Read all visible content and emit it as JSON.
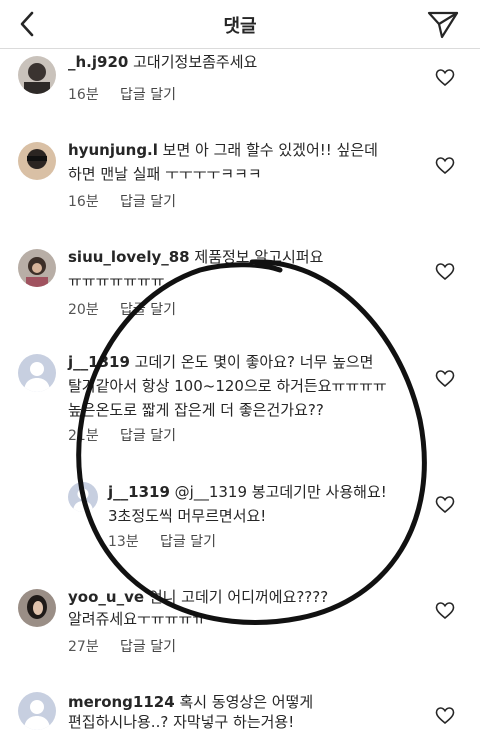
{
  "header": {
    "title": "댓글"
  },
  "comments": [
    {
      "username": "_h.j920",
      "lines": [
        "고대기정보좀주세요"
      ],
      "time": "16분",
      "reply_label": "답글 달기"
    },
    {
      "username": "hyunjung.l",
      "lines": [
        "보면 아 그래 할수 있겠어!! 싶은데",
        "하면 맨날 실패 ㅜㅜㅜㅜㅋㅋㅋ"
      ],
      "time": "16분",
      "reply_label": "답글 달기"
    },
    {
      "username": "siuu_lovely_88",
      "lines": [
        "제품정보 알고시퍼요",
        "ㅠㅠㅠㅠㅠㅠㅠ"
      ],
      "time": "20분",
      "reply_label": "답글 달기"
    },
    {
      "username": "j__1319",
      "lines": [
        "고데기 온도 몇이 좋아요? 너무 높으면",
        "탈거같아서 항상 100~120으로 하거든요ㅠㅠㅠㅠ",
        "높은온도로 짧게 잡은게 더 좋은건가요??"
      ],
      "time": "21분",
      "reply_label": "답글 달기"
    },
    {
      "username": "j__1319",
      "lines": [
        "@j__1319 봉고데기만 사용해요!",
        "3초정도씩 머무르면서요!"
      ],
      "time": "13분",
      "reply_label": "답글 달기"
    },
    {
      "username": "yoo_u_ve",
      "lines": [
        "언니 고데기 어디꺼에요????",
        "알려쥬세요ㅜㅠㅠㅠㅠ"
      ],
      "time": "27분",
      "reply_label": "답글 달기"
    },
    {
      "username": "merong1124",
      "lines": [
        "혹시 동영상은 어떻게",
        "편집하시나용..? 자막넣구 하는거용!"
      ],
      "time": "",
      "reply_label": ""
    }
  ],
  "colors": {
    "text": "#262626",
    "divider": "#dbdbdb",
    "circle": "#111111"
  }
}
